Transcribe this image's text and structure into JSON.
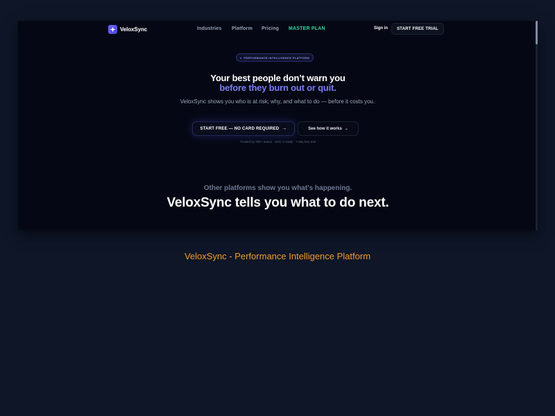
{
  "nav": {
    "brand": "VeloxSync",
    "links": [
      "Industries",
      "Platform",
      "Pricing",
      "MASTER PLAN"
    ],
    "sign_in": "Sign in",
    "cta": "START FREE TRIAL"
  },
  "hero": {
    "badge": "PERFORMANCE INTELLIGENCE PLATFORM",
    "headline_1": "Your best people don’t warn you",
    "headline_2": "before they burn out or quit.",
    "subtitle": "VeloxSync shows you who is at risk, why, and what to do — before it costs you.",
    "cta_primary": "START FREE — NO CARD REQUIRED",
    "cta_secondary": "See how it works",
    "trust": "Trusted by 200+ teams · SOC 2-ready · 7-day free trial"
  },
  "tagline": {
    "muted": "Other platforms show you what's happening.",
    "main": "VeloxSync tells you what to do next."
  },
  "caption": "VeloxSync - Performance Intelligence Platform",
  "icons": {
    "logo": "sparkle-icon",
    "cta_arrow": "arrow-right-icon",
    "secondary_chevron": "chevron-down-icon",
    "badge_dot": "dot-icon"
  },
  "colors": {
    "accent": "#7b7cf7",
    "master_plan": "#35d3a2",
    "caption": "#f09a2a",
    "background": "#0e1628",
    "frame": "#050814"
  }
}
